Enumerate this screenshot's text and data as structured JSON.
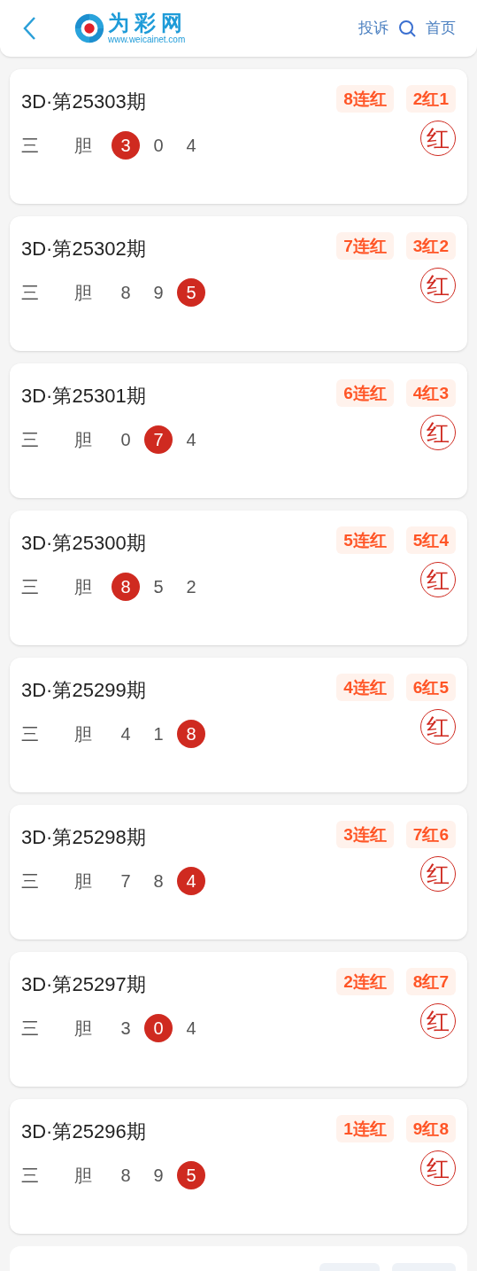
{
  "header": {
    "logo_title": "为彩网",
    "logo_url": "www.weicainet.com",
    "links": [
      "投诉",
      "首页"
    ]
  },
  "cards": [
    {
      "title": "3D·第25303期",
      "badges": [
        "8连红",
        "2红1"
      ],
      "labels": [
        "三",
        "胆"
      ],
      "digits": [
        {
          "value": "3",
          "selected": true
        },
        {
          "value": "0",
          "selected": false
        },
        {
          "value": "4",
          "selected": false
        }
      ],
      "result": "红"
    },
    {
      "title": "3D·第25302期",
      "badges": [
        "7连红",
        "3红2"
      ],
      "labels": [
        "三",
        "胆"
      ],
      "digits": [
        {
          "value": "8",
          "selected": false
        },
        {
          "value": "9",
          "selected": false
        },
        {
          "value": "5",
          "selected": true
        }
      ],
      "result": "红"
    },
    {
      "title": "3D·第25301期",
      "badges": [
        "6连红",
        "4红3"
      ],
      "labels": [
        "三",
        "胆"
      ],
      "digits": [
        {
          "value": "0",
          "selected": false
        },
        {
          "value": "7",
          "selected": true
        },
        {
          "value": "4",
          "selected": false
        }
      ],
      "result": "红"
    },
    {
      "title": "3D·第25300期",
      "badges": [
        "5连红",
        "5红4"
      ],
      "labels": [
        "三",
        "胆"
      ],
      "digits": [
        {
          "value": "8",
          "selected": true
        },
        {
          "value": "5",
          "selected": false
        },
        {
          "value": "2",
          "selected": false
        }
      ],
      "result": "红"
    },
    {
      "title": "3D·第25299期",
      "badges": [
        "4连红",
        "6红5"
      ],
      "labels": [
        "三",
        "胆"
      ],
      "digits": [
        {
          "value": "4",
          "selected": false
        },
        {
          "value": "1",
          "selected": false
        },
        {
          "value": "8",
          "selected": true
        }
      ],
      "result": "红"
    },
    {
      "title": "3D·第25298期",
      "badges": [
        "3连红",
        "7红6"
      ],
      "labels": [
        "三",
        "胆"
      ],
      "digits": [
        {
          "value": "7",
          "selected": false
        },
        {
          "value": "8",
          "selected": false
        },
        {
          "value": "4",
          "selected": true
        }
      ],
      "result": "红"
    },
    {
      "title": "3D·第25297期",
      "badges": [
        "2连红",
        "8红7"
      ],
      "labels": [
        "三",
        "胆"
      ],
      "digits": [
        {
          "value": "3",
          "selected": false
        },
        {
          "value": "0",
          "selected": true
        },
        {
          "value": "4",
          "selected": false
        }
      ],
      "result": "红"
    },
    {
      "title": "3D·第25296期",
      "badges": [
        "1连红",
        "9红8"
      ],
      "labels": [
        "三",
        "胆"
      ],
      "digits": [
        {
          "value": "8",
          "selected": false
        },
        {
          "value": "9",
          "selected": false
        },
        {
          "value": "5",
          "selected": true
        }
      ],
      "result": "红"
    }
  ]
}
